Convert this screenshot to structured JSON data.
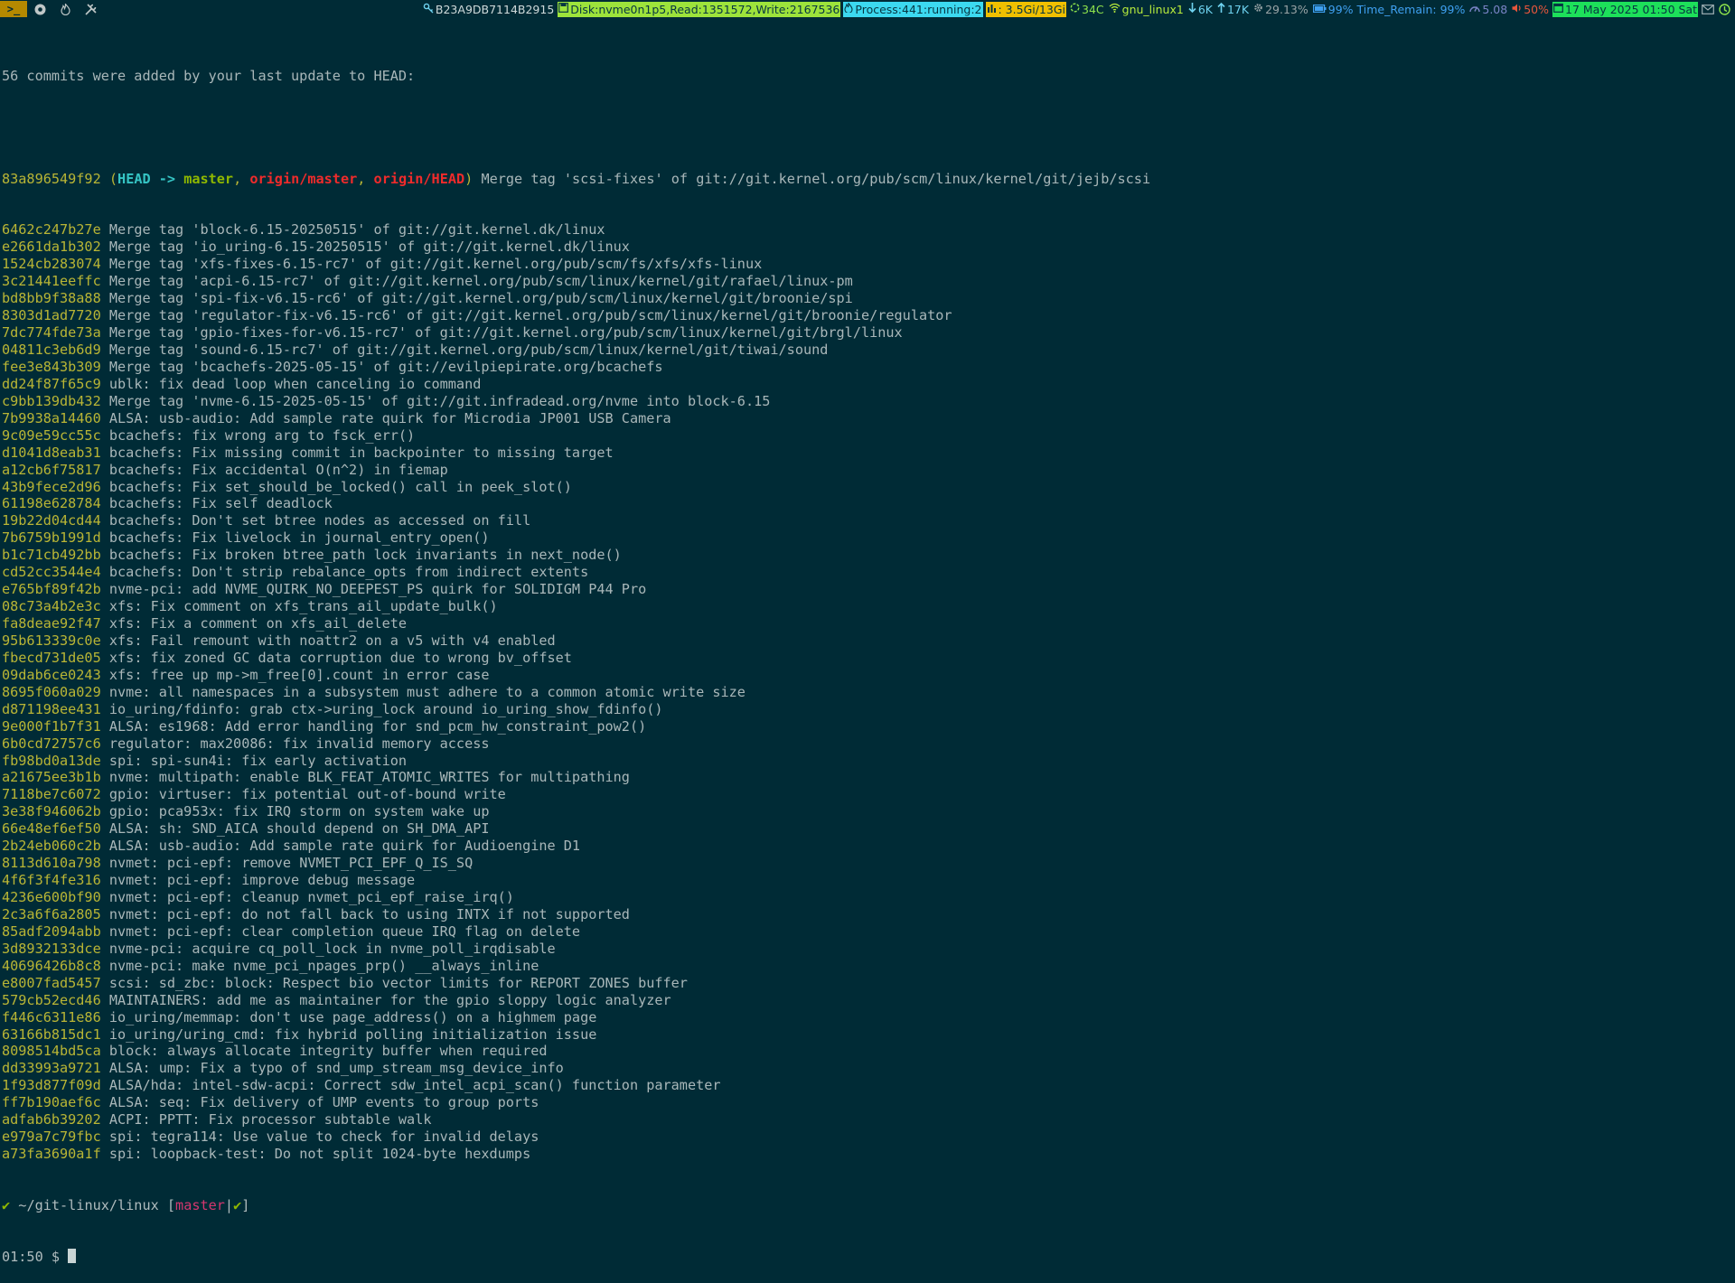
{
  "topbar": {
    "left_icons": [
      "terminal-icon",
      "chrome-icon",
      "flame-icon",
      "tools-icon"
    ],
    "terminal_glyph": ">_",
    "system_id": "B23A9DB7114B2915",
    "disk": "Disk:nvme0n1p5,Read:1351572,Write:2167536",
    "process": "Process:441:running:2",
    "memory": ": 3.5Gi/13Gi",
    "temp": "34C",
    "network": "gnu_linux1",
    "down_speed": "6K",
    "up_speed": "17K",
    "cpu": "29.13%",
    "battery": "99% Time_Remain: 99%",
    "load": "5.08",
    "volume": "50%",
    "datetime": "17 May 2025 01:50 Sat"
  },
  "terminal": {
    "header": "56 commits were added by your last update to HEAD:",
    "first_commit": {
      "hash": "83a896549f92",
      "refs": {
        "head": "HEAD",
        "arrow": " -> ",
        "local": "master",
        "remote1": "origin/master",
        "remote2": "origin/HEAD"
      },
      "message": "Merge tag 'scsi-fixes' of git://git.kernel.org/pub/scm/linux/kernel/git/jejb/scsi"
    },
    "commits": [
      {
        "hash": "6462c247b27e",
        "message": "Merge tag 'block-6.15-20250515' of git://git.kernel.dk/linux"
      },
      {
        "hash": "e2661da1b302",
        "message": "Merge tag 'io_uring-6.15-20250515' of git://git.kernel.dk/linux"
      },
      {
        "hash": "1524cb283074",
        "message": "Merge tag 'xfs-fixes-6.15-rc7' of git://git.kernel.org/pub/scm/fs/xfs/xfs-linux"
      },
      {
        "hash": "3c21441eeffc",
        "message": "Merge tag 'acpi-6.15-rc7' of git://git.kernel.org/pub/scm/linux/kernel/git/rafael/linux-pm"
      },
      {
        "hash": "bd8bb9f38a88",
        "message": "Merge tag 'spi-fix-v6.15-rc6' of git://git.kernel.org/pub/scm/linux/kernel/git/broonie/spi"
      },
      {
        "hash": "8303d1ad7720",
        "message": "Merge tag 'regulator-fix-v6.15-rc6' of git://git.kernel.org/pub/scm/linux/kernel/git/broonie/regulator"
      },
      {
        "hash": "7dc774fde73a",
        "message": "Merge tag 'gpio-fixes-for-v6.15-rc7' of git://git.kernel.org/pub/scm/linux/kernel/git/brgl/linux"
      },
      {
        "hash": "04811c3eb6d9",
        "message": "Merge tag 'sound-6.15-rc7' of git://git.kernel.org/pub/scm/linux/kernel/git/tiwai/sound"
      },
      {
        "hash": "fee3e843b309",
        "message": "Merge tag 'bcachefs-2025-05-15' of git://evilpiepirate.org/bcachefs"
      },
      {
        "hash": "dd24f87f65c9",
        "message": "ublk: fix dead loop when canceling io command"
      },
      {
        "hash": "c9bb139db432",
        "message": "Merge tag 'nvme-6.15-2025-05-15' of git://git.infradead.org/nvme into block-6.15"
      },
      {
        "hash": "7b9938a14460",
        "message": "ALSA: usb-audio: Add sample rate quirk for Microdia JP001 USB Camera"
      },
      {
        "hash": "9c09e59cc55c",
        "message": "bcachefs: fix wrong arg to fsck_err()"
      },
      {
        "hash": "d1041d8eab31",
        "message": "bcachefs: Fix missing commit in backpointer to missing target"
      },
      {
        "hash": "a12cb6f75817",
        "message": "bcachefs: Fix accidental O(n^2) in fiemap"
      },
      {
        "hash": "43b9fece2d96",
        "message": "bcachefs: Fix set_should_be_locked() call in peek_slot()"
      },
      {
        "hash": "61198e628784",
        "message": "bcachefs: Fix self deadlock"
      },
      {
        "hash": "19b22d04cd44",
        "message": "bcachefs: Don't set btree nodes as accessed on fill"
      },
      {
        "hash": "7b6759b1991d",
        "message": "bcachefs: Fix livelock in journal_entry_open()"
      },
      {
        "hash": "b1c71cb492bb",
        "message": "bcachefs: Fix broken btree_path lock invariants in next_node()"
      },
      {
        "hash": "cd52cc3544e4",
        "message": "bcachefs: Don't strip rebalance_opts from indirect extents"
      },
      {
        "hash": "e765bf89f42b",
        "message": "nvme-pci: add NVME_QUIRK_NO_DEEPEST_PS quirk for SOLIDIGM P44 Pro"
      },
      {
        "hash": "08c73a4b2e3c",
        "message": "xfs: Fix comment on xfs_trans_ail_update_bulk()"
      },
      {
        "hash": "fa8deae92f47",
        "message": "xfs: Fix a comment on xfs_ail_delete"
      },
      {
        "hash": "95b613339c0e",
        "message": "xfs: Fail remount with noattr2 on a v5 with v4 enabled"
      },
      {
        "hash": "fbecd731de05",
        "message": "xfs: fix zoned GC data corruption due to wrong bv_offset"
      },
      {
        "hash": "09dab6ce0243",
        "message": "xfs: free up mp->m_free[0].count in error case"
      },
      {
        "hash": "8695f060a029",
        "message": "nvme: all namespaces in a subsystem must adhere to a common atomic write size"
      },
      {
        "hash": "d871198ee431",
        "message": "io_uring/fdinfo: grab ctx->uring_lock around io_uring_show_fdinfo()"
      },
      {
        "hash": "9e000f1b7f31",
        "message": "ALSA: es1968: Add error handling for snd_pcm_hw_constraint_pow2()"
      },
      {
        "hash": "6b0cd72757c6",
        "message": "regulator: max20086: fix invalid memory access"
      },
      {
        "hash": "fb98bd0a13de",
        "message": "spi: spi-sun4i: fix early activation"
      },
      {
        "hash": "a21675ee3b1b",
        "message": "nvme: multipath: enable BLK_FEAT_ATOMIC_WRITES for multipathing"
      },
      {
        "hash": "7118be7c6072",
        "message": "gpio: virtuser: fix potential out-of-bound write"
      },
      {
        "hash": "3e38f946062b",
        "message": "gpio: pca953x: fix IRQ storm on system wake up"
      },
      {
        "hash": "66e48ef6ef50",
        "message": "ALSA: sh: SND_AICA should depend on SH_DMA_API"
      },
      {
        "hash": "2b24eb060c2b",
        "message": "ALSA: usb-audio: Add sample rate quirk for Audioengine D1"
      },
      {
        "hash": "8113d610a798",
        "message": "nvmet: pci-epf: remove NVMET_PCI_EPF_Q_IS_SQ"
      },
      {
        "hash": "4f6f3f4fe316",
        "message": "nvmet: pci-epf: improve debug message"
      },
      {
        "hash": "4236e600bf90",
        "message": "nvmet: pci-epf: cleanup nvmet_pci_epf_raise_irq()"
      },
      {
        "hash": "2c3a6f6a2805",
        "message": "nvmet: pci-epf: do not fall back to using INTX if not supported"
      },
      {
        "hash": "85adf2094abb",
        "message": "nvmet: pci-epf: clear completion queue IRQ flag on delete"
      },
      {
        "hash": "3d8932133dce",
        "message": "nvme-pci: acquire cq_poll_lock in nvme_poll_irqdisable"
      },
      {
        "hash": "40696426b8c8",
        "message": "nvme-pci: make nvme_pci_npages_prp() __always_inline"
      },
      {
        "hash": "e8007fad5457",
        "message": "scsi: sd_zbc: block: Respect bio vector limits for REPORT ZONES buffer"
      },
      {
        "hash": "579cb52ecd46",
        "message": "MAINTAINERS: add me as maintainer for the gpio sloppy logic analyzer"
      },
      {
        "hash": "f446c6311e86",
        "message": "io_uring/memmap: don't use page_address() on a highmem page"
      },
      {
        "hash": "63166b815dc1",
        "message": "io_uring/uring_cmd: fix hybrid polling initialization issue"
      },
      {
        "hash": "8098514bd5ca",
        "message": "block: always allocate integrity buffer when required"
      },
      {
        "hash": "dd33993a9721",
        "message": "ALSA: ump: Fix a typo of snd_ump_stream_msg_device_info"
      },
      {
        "hash": "1f93d877f09d",
        "message": "ALSA/hda: intel-sdw-acpi: Correct sdw_intel_acpi_scan() function parameter"
      },
      {
        "hash": "ff7b190aef6c",
        "message": "ALSA: seq: Fix delivery of UMP events to group ports"
      },
      {
        "hash": "adfab6b39202",
        "message": "ACPI: PPTT: Fix processor subtable walk"
      },
      {
        "hash": "e979a7c79fbc",
        "message": "spi: tegra114: Use value to check for invalid delays"
      },
      {
        "hash": "a73fa3690a1f",
        "message": "spi: loopback-test: Do not split 1024-byte hexdumps"
      }
    ],
    "prompt": {
      "check": "✔",
      "path": " ~/git-linux/linux ",
      "branch_open": "[",
      "branch": "master",
      "branch_sep": "|",
      "branch_status": "✔",
      "branch_close": "]",
      "time": "01:50",
      "symbol": " $ "
    }
  },
  "colors": {
    "background": "#002b36",
    "hash": "#b9b535",
    "head_ref": "#35c4c4",
    "local_ref": "#8fb800",
    "remote_ref": "#f02b2b",
    "branch": "#d6376f"
  }
}
